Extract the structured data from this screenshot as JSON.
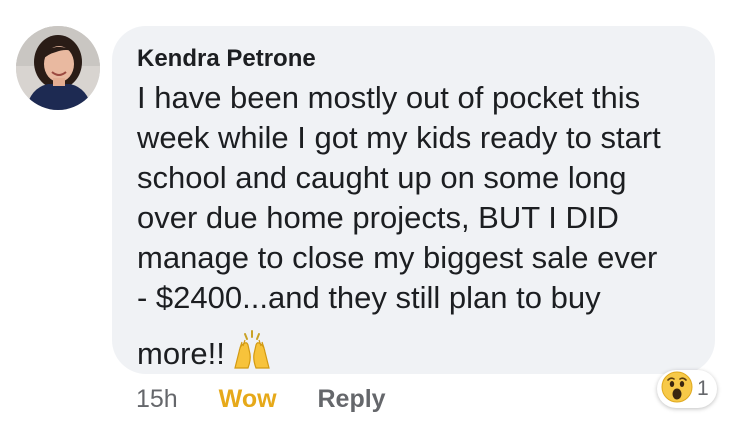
{
  "comment": {
    "author": "Kendra Petrone",
    "text_lines": [
      "I have been mostly out of pocket this",
      "week while I got my kids ready to start",
      "school and caught up on some long",
      "over due home projects, BUT I DID",
      "manage to close my biggest sale ever",
      "- $2400...and they still plan to buy",
      "more!!"
    ],
    "inline_emoji": "raising-hands-icon",
    "bubble_color": "#f0f2f5"
  },
  "actions": {
    "timestamp": "15h",
    "reaction_label": "Wow",
    "reaction_label_color": "#e6a91a",
    "reply_label": "Reply"
  },
  "reactions": {
    "icon": "wow-face-icon",
    "count": "1"
  }
}
